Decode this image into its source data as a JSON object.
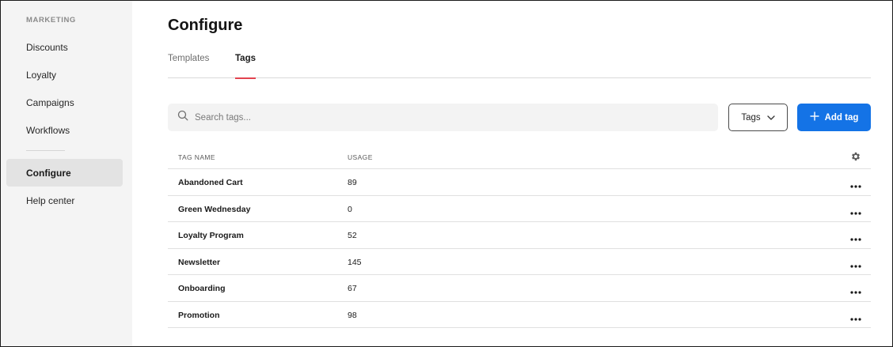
{
  "sidebar": {
    "section_title": "MARKETING",
    "items": [
      {
        "label": "Discounts"
      },
      {
        "label": "Loyalty"
      },
      {
        "label": "Campaigns"
      },
      {
        "label": "Workflows"
      }
    ],
    "bottom_items": [
      {
        "label": "Configure",
        "active": true
      },
      {
        "label": "Help center"
      }
    ]
  },
  "main": {
    "title": "Configure",
    "tabs": [
      {
        "label": "Templates"
      },
      {
        "label": "Tags",
        "active": true
      }
    ],
    "search": {
      "placeholder": "Search tags..."
    },
    "filter": {
      "label": "Tags"
    },
    "add_button": {
      "label": "Add tag"
    },
    "table": {
      "columns": [
        "TAG NAME",
        "USAGE"
      ],
      "rows": [
        {
          "name": "Abandoned Cart",
          "usage": "89"
        },
        {
          "name": "Green Wednesday",
          "usage": "0"
        },
        {
          "name": "Loyalty Program",
          "usage": "52"
        },
        {
          "name": "Newsletter",
          "usage": "145"
        },
        {
          "name": "Onboarding",
          "usage": "67"
        },
        {
          "name": "Promotion",
          "usage": "98"
        }
      ]
    }
  },
  "colors": {
    "accent": "#1473e6",
    "tab_indicator": "#e2434f",
    "sidebar_bg": "#f4f4f4"
  },
  "icons": {
    "search": "search-icon",
    "chevron": "chevron-down-icon",
    "plus": "plus-icon",
    "gear": "gear-icon",
    "more": "more-horizontal-icon"
  }
}
